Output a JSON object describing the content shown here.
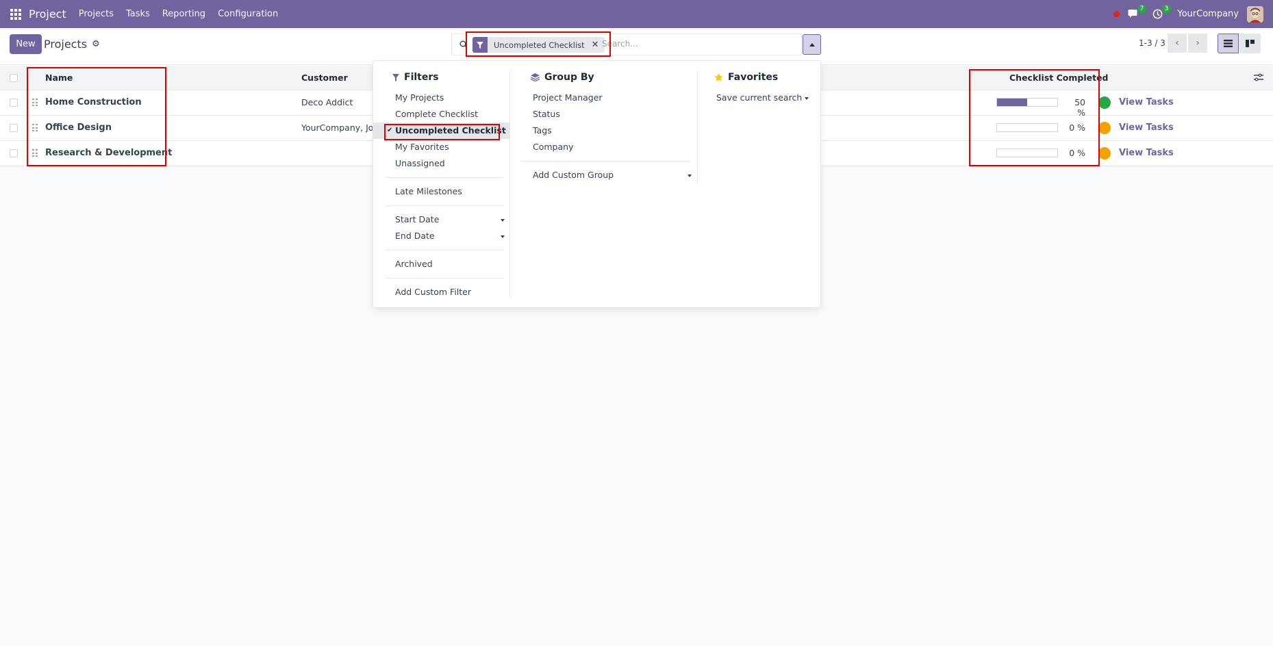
{
  "navbar": {
    "app_name": "Project",
    "menu": [
      "Projects",
      "Tasks",
      "Reporting",
      "Configuration"
    ],
    "messages_count": "7",
    "activities_count": "3",
    "company": "YourCompany"
  },
  "control": {
    "new_label": "New",
    "breadcrumb": "Projects",
    "facet_label": "Uncompleted Checklist",
    "search_placeholder": "Search...",
    "pager": "1-3 / 3"
  },
  "table": {
    "headers": {
      "name": "Name",
      "customer": "Customer",
      "checklist": "Checklist Completed"
    },
    "rows": [
      {
        "name": "Home Construction",
        "customer": "Deco Addict",
        "progress": 50,
        "progress_label": "50 %",
        "status_color": "#28a745",
        "link": "View Tasks"
      },
      {
        "name": "Office Design",
        "customer": "YourCompany, Joel Willis",
        "progress": 0,
        "progress_label": "0 %",
        "status_color": "#f4a100",
        "link": "View Tasks"
      },
      {
        "name": "Research & Development",
        "customer": "",
        "progress": 0,
        "progress_label": "0 %",
        "status_color": "#f4a100",
        "link": "View Tasks"
      }
    ]
  },
  "dropdown": {
    "filters_title": "Filters",
    "filters": [
      "My Projects",
      "Complete Checklist",
      "Uncompleted Checklist",
      "My Favorites",
      "Unassigned"
    ],
    "late_milestones": "Late Milestones",
    "start_date": "Start Date",
    "end_date": "End Date",
    "archived": "Archived",
    "add_custom_filter": "Add Custom Filter",
    "groupby_title": "Group By",
    "groupby": [
      "Project Manager",
      "Status",
      "Tags",
      "Company"
    ],
    "add_custom_group": "Add Custom Group",
    "favorites_title": "Favorites",
    "save_current_search": "Save current search"
  },
  "colors": {
    "brand": "#71639e",
    "highlight": "#e00000"
  }
}
